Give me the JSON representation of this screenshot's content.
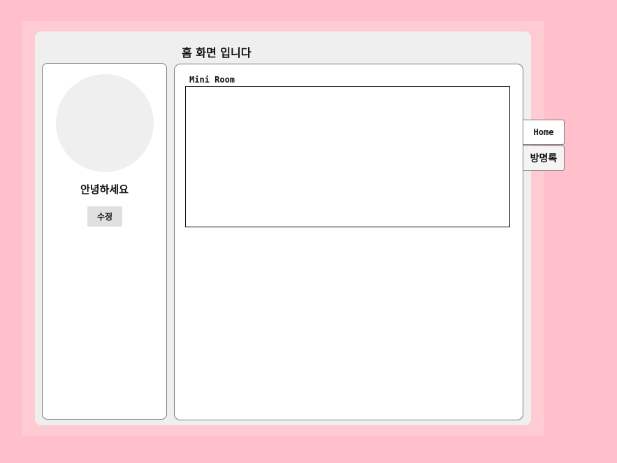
{
  "header": {
    "title": "홈 화면 입니다"
  },
  "profile": {
    "greeting": "안녕하세요",
    "edit_label": "수정"
  },
  "main": {
    "mini_room_label": "Mini Room"
  },
  "nav": {
    "tabs": [
      {
        "label": "Home"
      },
      {
        "label": "방명록"
      }
    ]
  },
  "colors": {
    "background": "#ffc0cb",
    "frame": "#ffcbd2",
    "card": "#efefef",
    "panel": "#ffffff"
  }
}
